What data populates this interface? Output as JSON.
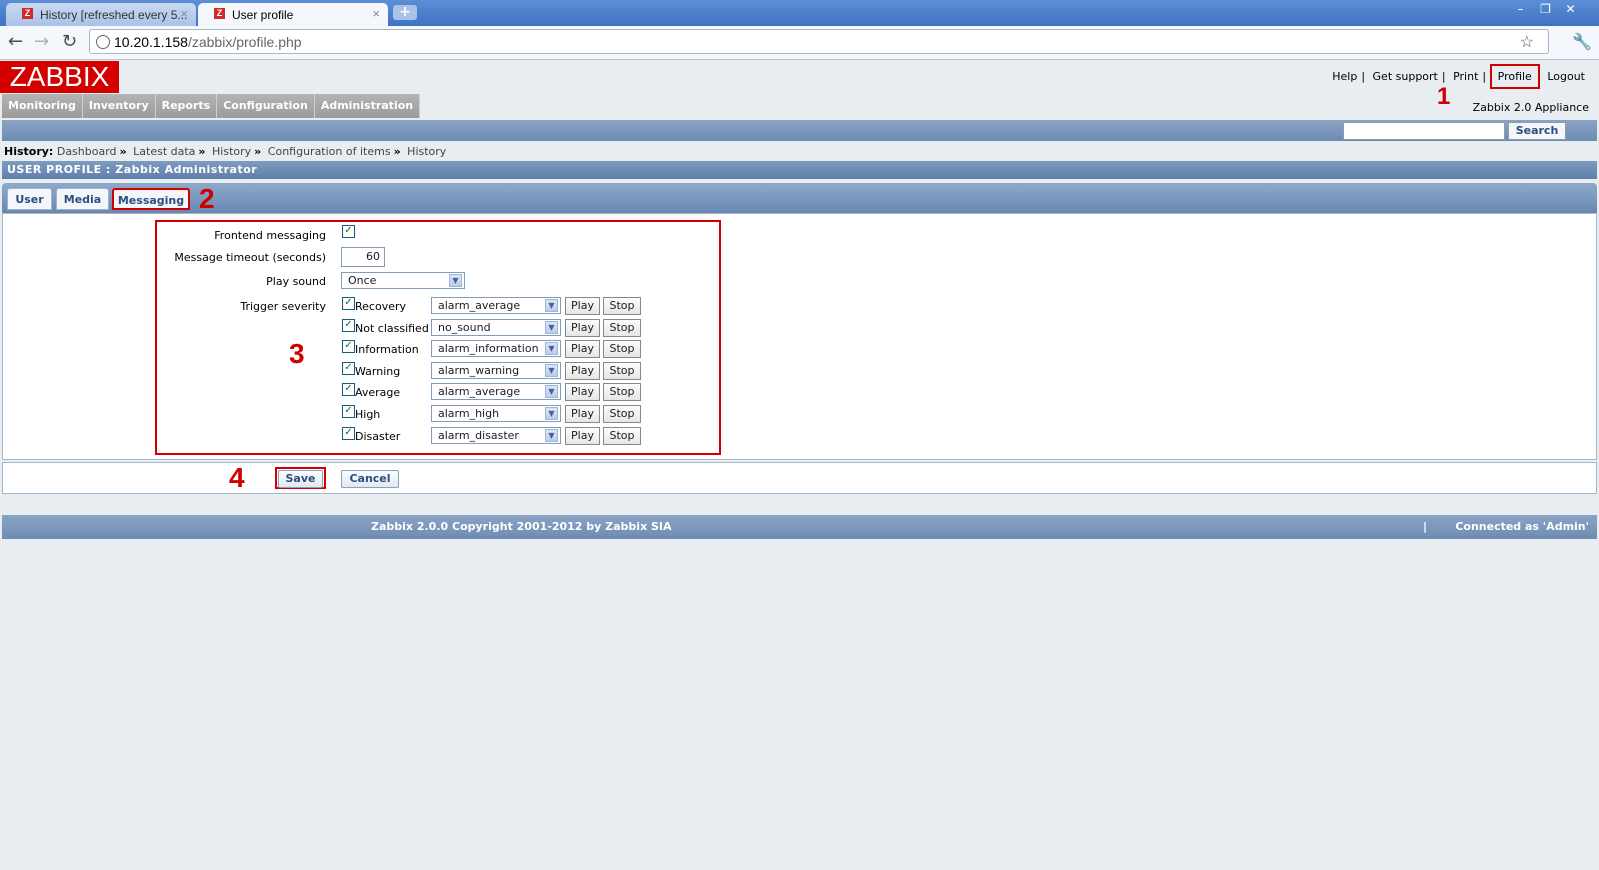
{
  "browser": {
    "tabs": [
      {
        "label": "History [refreshed every 5...",
        "active": false
      },
      {
        "label": "User profile",
        "active": true
      }
    ],
    "url_host": "10.20.1.158",
    "url_path": "/zabbix/profile.php"
  },
  "header": {
    "logo": "ZABBIX",
    "links": {
      "help": "Help",
      "support": "Get support",
      "print": "Print",
      "profile": "Profile",
      "logout": "Logout"
    },
    "appliance": "Zabbix 2.0 Appliance"
  },
  "menu": [
    "Monitoring",
    "Inventory",
    "Reports",
    "Configuration",
    "Administration"
  ],
  "search": {
    "button": "Search",
    "value": ""
  },
  "history": {
    "label": "History:",
    "items": [
      "Dashboard",
      "Latest data",
      "History",
      "Configuration of items",
      "History"
    ]
  },
  "page_title": "USER PROFILE : Zabbix Administrator",
  "tabs": [
    "User",
    "Media",
    "Messaging"
  ],
  "selected_tab": "Messaging",
  "form": {
    "frontend_messaging_label": "Frontend messaging",
    "frontend_messaging_checked": true,
    "timeout_label": "Message timeout (seconds)",
    "timeout_value": "60",
    "play_sound_label": "Play sound",
    "play_sound_value": "Once",
    "trigger_severity_label": "Trigger severity",
    "severities": [
      {
        "name": "Recovery",
        "sound": "alarm_average",
        "checked": true
      },
      {
        "name": "Not classified",
        "sound": "no_sound",
        "checked": true
      },
      {
        "name": "Information",
        "sound": "alarm_information",
        "checked": true
      },
      {
        "name": "Warning",
        "sound": "alarm_warning",
        "checked": true
      },
      {
        "name": "Average",
        "sound": "alarm_average",
        "checked": true
      },
      {
        "name": "High",
        "sound": "alarm_high",
        "checked": true
      },
      {
        "name": "Disaster",
        "sound": "alarm_disaster",
        "checked": true
      }
    ],
    "play_label": "Play",
    "stop_label": "Stop"
  },
  "actions": {
    "save": "Save",
    "cancel": "Cancel"
  },
  "annotations": {
    "n1": "1",
    "n2": "2",
    "n3": "3",
    "n4": "4",
    "color": "#d00000"
  },
  "footer": {
    "copyright": "Zabbix 2.0.0 Copyright 2001-2012 by Zabbix SIA",
    "connected": "Connected as 'Admin'"
  }
}
